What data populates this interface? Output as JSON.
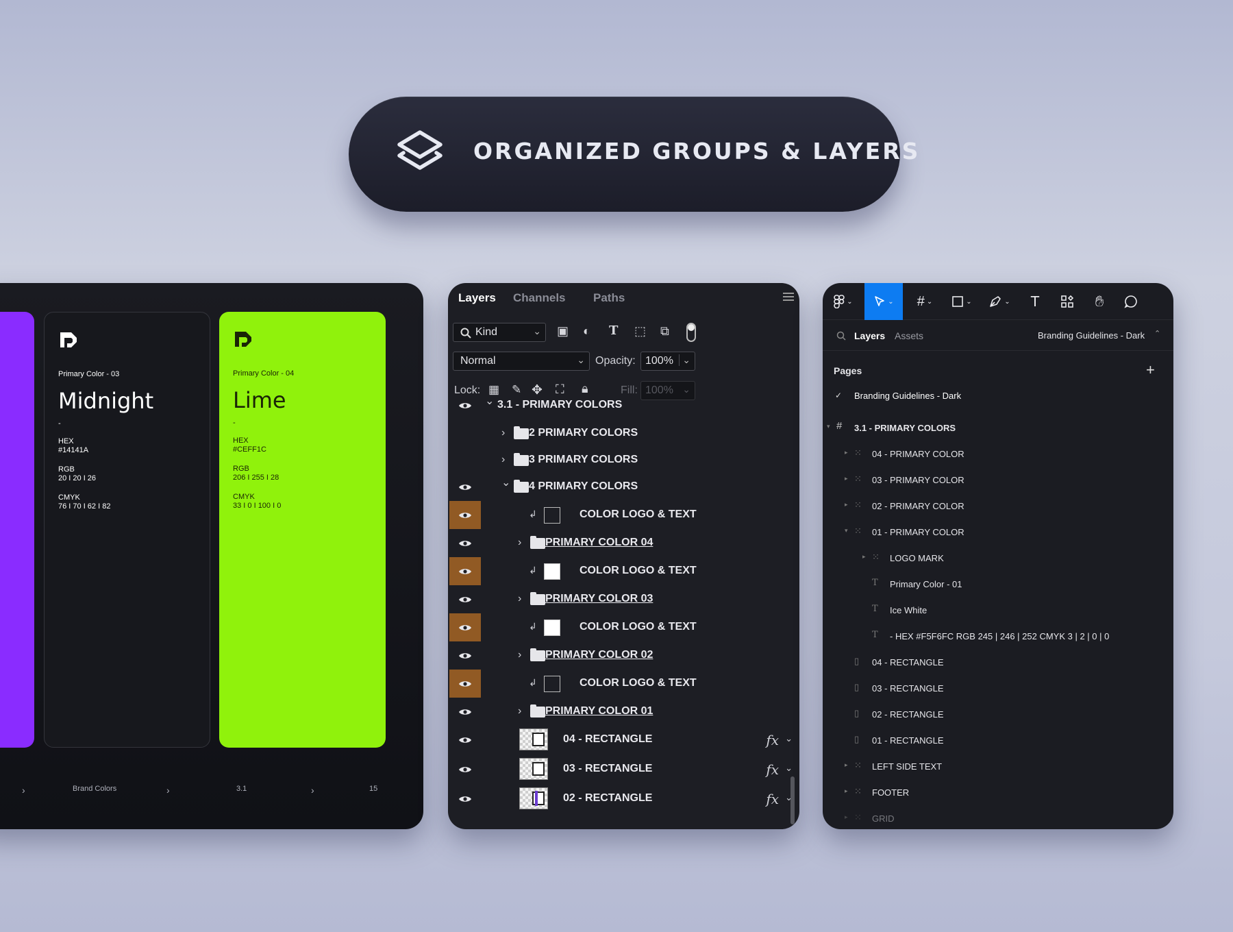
{
  "banner": {
    "title": "ORGANIZED GROUPS & LAYERS",
    "icon": "layers-icon"
  },
  "brand_panel": {
    "cards": [
      {
        "label": "Primary Color - 03",
        "name": "Midnight",
        "dash": "-",
        "hex_label": "HEX",
        "hex": "#14141A",
        "rgb_label": "RGB",
        "rgb": "20 I 20 I 26",
        "cmyk_label": "CMYK",
        "cmyk": "76 I 70 I 62 I 82",
        "bg": "#17181d"
      },
      {
        "label": "Primary Color - 04",
        "name": "Lime",
        "dash": "-",
        "hex_label": "HEX",
        "hex": "#CEFF1C",
        "rgb_label": "RGB",
        "rgb": "206 I 255 I 28",
        "cmyk_label": "CMYK",
        "cmyk": "33 I 0 I 100 I 0",
        "bg": "#90f20c"
      }
    ],
    "side_color": "#8a2cff",
    "breadcrumbs": {
      "sep": "›",
      "section": "Brand Colors",
      "number": "3.1",
      "page": "15"
    }
  },
  "photoshop": {
    "tabs": [
      "Layers",
      "Channels",
      "Paths"
    ],
    "filter": {
      "label": "Kind"
    },
    "blend_mode": "Normal",
    "opacity_label": "Opacity:",
    "opacity": "100%",
    "lock_label": "Lock:",
    "fill_label": "Fill:",
    "fill": "100%",
    "layers": [
      {
        "name": "3.1 - PRIMARY COLORS",
        "eye": true,
        "highlight": false
      },
      {
        "name": "2 PRIMARY COLORS",
        "eye": false,
        "highlight": false
      },
      {
        "name": "3 PRIMARY COLORS",
        "eye": false,
        "highlight": false
      },
      {
        "name": "4 PRIMARY COLORS",
        "eye": true,
        "highlight": false
      },
      {
        "name": "COLOR LOGO & TEXT",
        "eye": true,
        "highlight": true
      },
      {
        "name": "PRIMARY COLOR 04",
        "eye": true,
        "highlight": false
      },
      {
        "name": "COLOR LOGO & TEXT",
        "eye": true,
        "highlight": true
      },
      {
        "name": "PRIMARY COLOR 03",
        "eye": true,
        "highlight": false
      },
      {
        "name": "COLOR LOGO & TEXT",
        "eye": true,
        "highlight": true
      },
      {
        "name": "PRIMARY COLOR 02",
        "eye": true,
        "highlight": false
      },
      {
        "name": "COLOR LOGO & TEXT",
        "eye": true,
        "highlight": true
      },
      {
        "name": "PRIMARY COLOR 01",
        "eye": true,
        "highlight": false
      },
      {
        "name": "04 - RECTANGLE",
        "eye": true,
        "highlight": false,
        "fx": "fx"
      },
      {
        "name": "03 - RECTANGLE",
        "eye": true,
        "highlight": false,
        "fx": "fx"
      },
      {
        "name": "02 - RECTANGLE",
        "eye": true,
        "highlight": false,
        "fx": "fx"
      }
    ],
    "highlight_color": "#915a24"
  },
  "figma": {
    "toolbar": [
      "figma-menu-icon",
      "move-tool-icon",
      "frame-tool-icon",
      "shape-tool-icon",
      "pen-tool-icon",
      "text-tool-icon",
      "components-icon",
      "hand-tool-icon",
      "comment-icon"
    ],
    "accent": "#0d7cf2",
    "tabs": {
      "layers": "Layers",
      "assets": "Assets"
    },
    "file_name": "Branding Guidelines - Dark",
    "pages_label": "Pages",
    "add": "+",
    "current_page": "Branding Guidelines - Dark",
    "tree": [
      {
        "name": "3.1 - PRIMARY COLORS",
        "icon": "#"
      },
      {
        "name": "04 - PRIMARY COLOR",
        "icon": "frame"
      },
      {
        "name": "03 - PRIMARY COLOR",
        "icon": "frame"
      },
      {
        "name": "02 - PRIMARY COLOR",
        "icon": "frame"
      },
      {
        "name": "01 - PRIMARY COLOR",
        "icon": "frame"
      },
      {
        "name": "LOGO MARK",
        "icon": "frame"
      },
      {
        "name": "Primary Color - 01",
        "icon": "T"
      },
      {
        "name": "Ice White",
        "icon": "T"
      },
      {
        "name": "- HEX #F5F6FC RGB 245 | 246 | 252 CMYK 3 | 2 | 0 | 0",
        "icon": "T"
      },
      {
        "name": "04 - RECTANGLE",
        "icon": "rect"
      },
      {
        "name": "03 - RECTANGLE",
        "icon": "rect"
      },
      {
        "name": "02 - RECTANGLE",
        "icon": "rect"
      },
      {
        "name": "01 - RECTANGLE",
        "icon": "rect"
      },
      {
        "name": "LEFT SIDE TEXT",
        "icon": "frame"
      },
      {
        "name": "FOOTER",
        "icon": "frame"
      },
      {
        "name": "GRID",
        "icon": "frame"
      }
    ]
  }
}
